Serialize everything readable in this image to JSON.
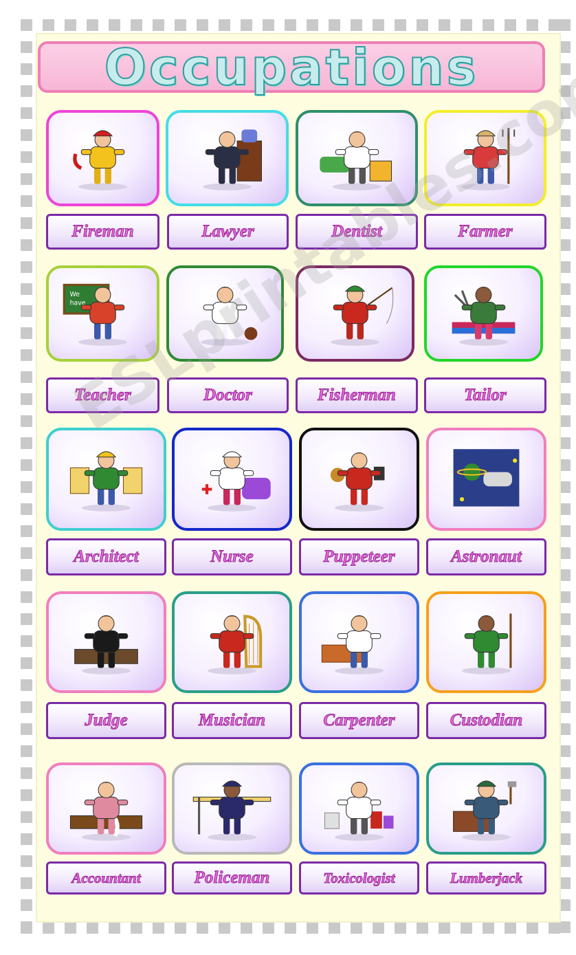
{
  "title": "Occupations",
  "watermark": "ESLprintables.com",
  "occupations": [
    {
      "name": "Fireman",
      "icon": "fireman-icon",
      "card_border": "#ee44d8"
    },
    {
      "name": "Lawyer",
      "icon": "lawyer-icon",
      "card_border": "#43dde8"
    },
    {
      "name": "Dentist",
      "icon": "dentist-icon",
      "card_border": "#2f8f6c"
    },
    {
      "name": "Farmer",
      "icon": "farmer-icon",
      "card_border": "#f2ee2a"
    },
    {
      "name": "Teacher",
      "icon": "teacher-icon",
      "card_border": "#a6d13a"
    },
    {
      "name": "Doctor",
      "icon": "doctor-icon",
      "card_border": "#2f8a32"
    },
    {
      "name": "Fisherman",
      "icon": "fisherman-icon",
      "card_border": "#7b2b62"
    },
    {
      "name": "Tailor",
      "icon": "tailor-icon",
      "card_border": "#22d62a"
    },
    {
      "name": "Architect",
      "icon": "architect-icon",
      "card_border": "#3fcfcf"
    },
    {
      "name": "Nurse",
      "icon": "nurse-icon",
      "card_border": "#1428c8"
    },
    {
      "name": "Puppeteer",
      "icon": "puppeteer-icon",
      "card_border": "#111111"
    },
    {
      "name": "Astronaut",
      "icon": "astronaut-icon",
      "card_border": "#f07fbe"
    },
    {
      "name": "Judge",
      "icon": "judge-icon",
      "card_border": "#f07fbe"
    },
    {
      "name": "Musician",
      "icon": "musician-icon",
      "card_border": "#2a9e8a"
    },
    {
      "name": "Carpenter",
      "icon": "carpenter-icon",
      "card_border": "#3a6fe0"
    },
    {
      "name": "Custodian",
      "icon": "custodian-icon",
      "card_border": "#f5a01c"
    },
    {
      "name": "Accountant",
      "icon": "accountant-icon",
      "card_border": "#f07fbe"
    },
    {
      "name": "Policeman",
      "icon": "policeman-icon",
      "card_border": "#b8b8b8"
    },
    {
      "name": "Toxicologist",
      "icon": "toxicologist-icon",
      "card_border": "#3a6fe0"
    },
    {
      "name": "Lumberjack",
      "icon": "lumberjack-icon",
      "card_border": "#2a9e8a"
    }
  ]
}
